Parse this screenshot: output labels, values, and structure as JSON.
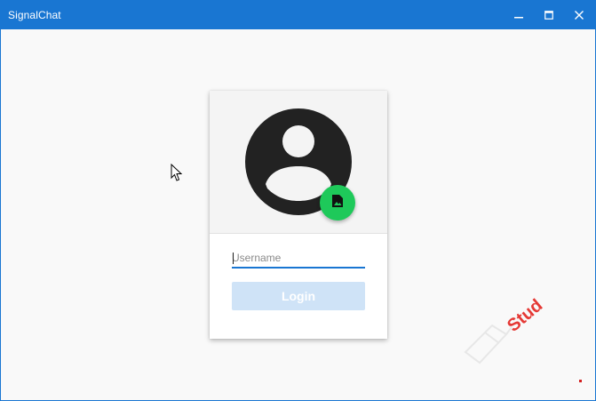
{
  "window": {
    "title": "SignalChat"
  },
  "titlebar_icons": {
    "minimize": "minimize-icon",
    "maximize": "maximize-icon",
    "close": "close-icon"
  },
  "login_card": {
    "avatar_icon": "user-avatar-icon",
    "photo_button_icon": "image-file-icon",
    "username": {
      "value": "",
      "placeholder": "Username"
    },
    "login_label": "Login"
  },
  "watermark": {
    "text": "Stud"
  },
  "colors": {
    "accent": "#1976d2",
    "fab": "#1ec95a",
    "login_disabled": "#cfe3f7",
    "avatar": "#222222",
    "watermark": "#e53935"
  }
}
